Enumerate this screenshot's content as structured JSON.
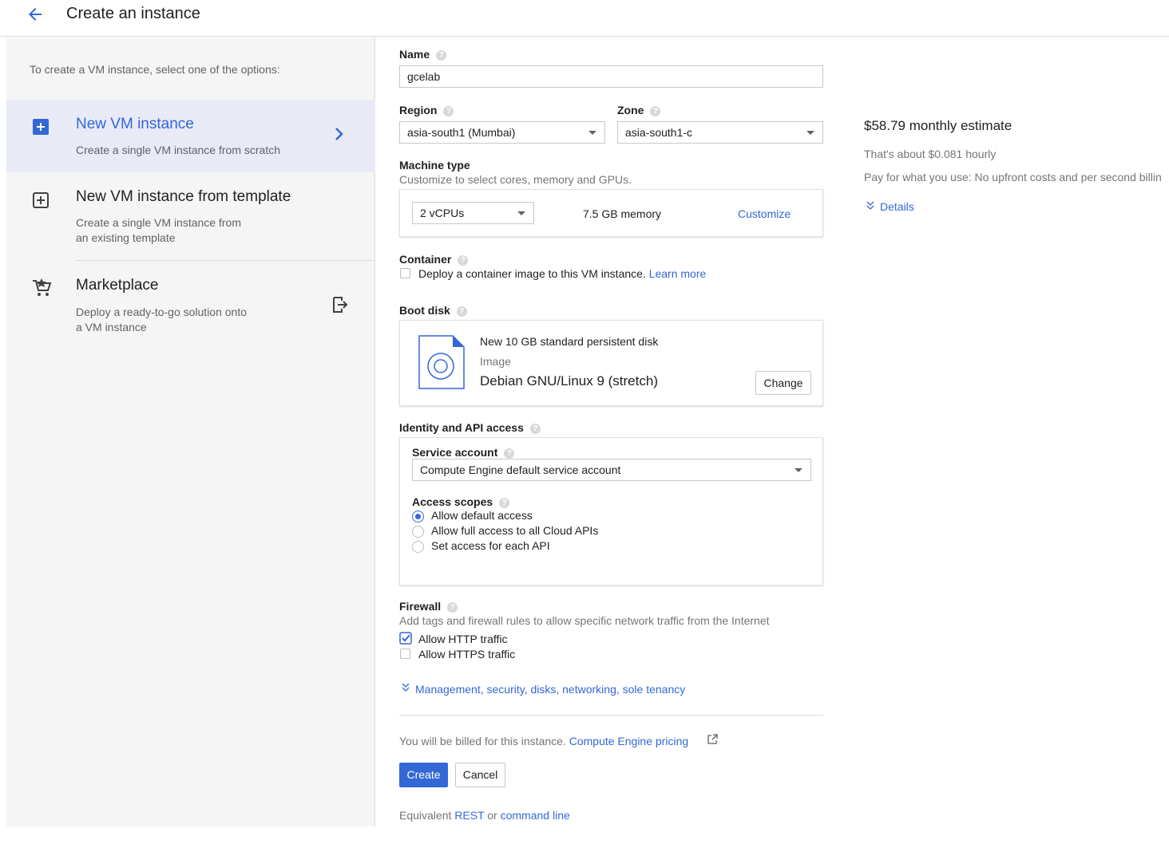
{
  "header": {
    "title": "Create an instance"
  },
  "sidebar": {
    "intro": "To create a VM instance, select one of the options:",
    "options": [
      {
        "title": "New VM instance",
        "desc": "Create a single VM instance from scratch"
      },
      {
        "title": "New VM instance from template",
        "desc1": "Create a single VM instance from",
        "desc2": "an existing template"
      },
      {
        "title": "Marketplace",
        "desc1": "Deploy a ready-to-go solution onto",
        "desc2": "a VM instance"
      }
    ]
  },
  "form": {
    "name": {
      "label": "Name",
      "value": "gcelab"
    },
    "region": {
      "label": "Region",
      "value": "asia-south1 (Mumbai)"
    },
    "zone": {
      "label": "Zone",
      "value": "asia-south1-c"
    },
    "machine": {
      "label": "Machine type",
      "hint": "Customize to select cores, memory and GPUs.",
      "cpus": "2 vCPUs",
      "memory": "7.5 GB memory",
      "customize": "Customize"
    },
    "container": {
      "label": "Container",
      "text": "Deploy a container image to this VM instance.",
      "learn": "Learn more"
    },
    "boot": {
      "label": "Boot disk",
      "disk": "New 10 GB standard persistent disk",
      "image_label": "Image",
      "image": "Debian GNU/Linux 9 (stretch)",
      "change": "Change"
    },
    "identity": {
      "label": "Identity and API access",
      "service_label": "Service account",
      "service_value": "Compute Engine default service account",
      "scopes_label": "Access scopes",
      "scopes": [
        "Allow default access",
        "Allow full access to all Cloud APIs",
        "Set access for each API"
      ]
    },
    "firewall": {
      "label": "Firewall",
      "hint": "Add tags and firewall rules to allow specific network traffic from the Internet",
      "http": "Allow HTTP traffic",
      "https": "Allow HTTPS traffic"
    },
    "management": "Management, security, disks, networking, sole tenancy",
    "billing": {
      "text": "You will be billed for this instance.",
      "link": "Compute Engine pricing"
    },
    "create": "Create",
    "cancel": "Cancel",
    "equivalent": {
      "prefix": "Equivalent",
      "rest": "REST",
      "or": "or",
      "cmd": "command line"
    }
  },
  "estimate": {
    "monthly": "$58.79 monthly estimate",
    "hourly": "That's about $0.081 hourly",
    "note": "Pay for what you use: No upfront costs and per second billin",
    "details": "Details"
  },
  "colors": {
    "accent": "#3367d6",
    "selected_bg": "#e8eaf6",
    "sidebar_bg": "#f5f5f5"
  }
}
